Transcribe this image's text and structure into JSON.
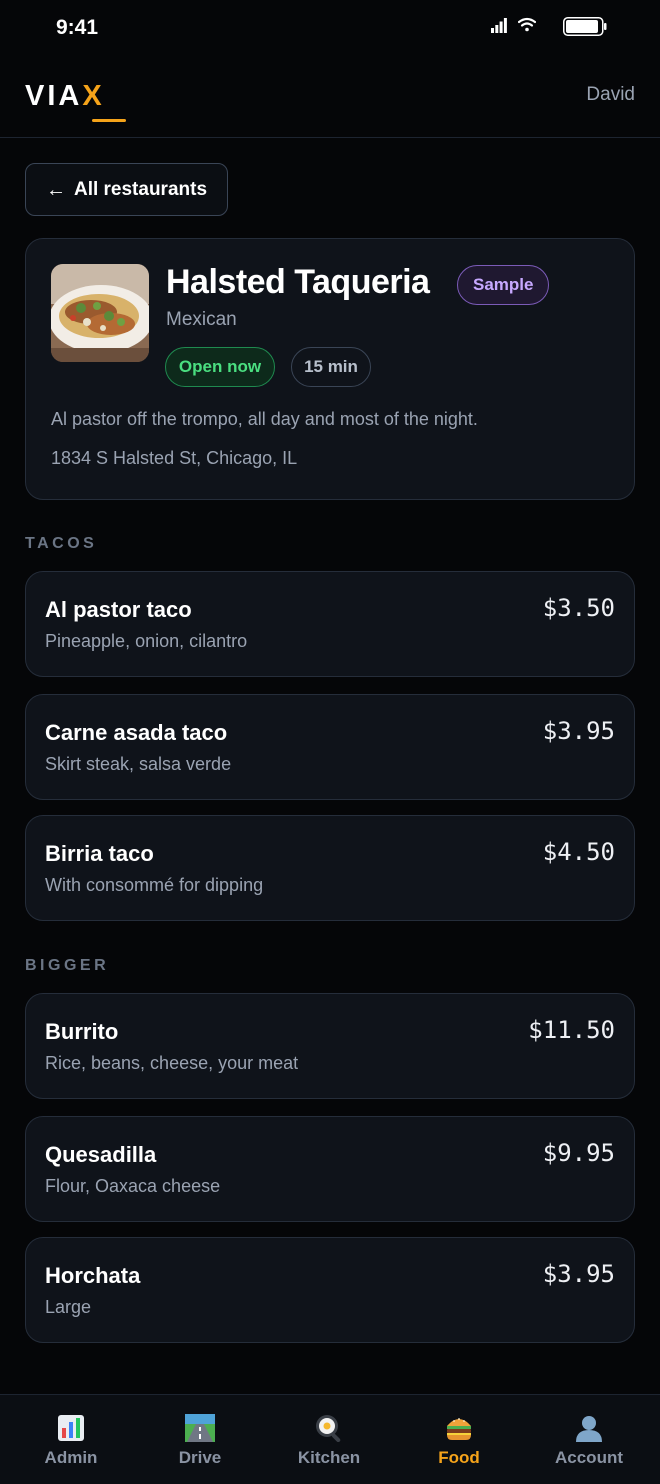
{
  "status_bar": {
    "time": "9:41"
  },
  "header": {
    "logo_main": "VIA",
    "logo_accent": "X",
    "user_name": "David"
  },
  "back_button": {
    "arrow": "←",
    "label": "All restaurants"
  },
  "restaurant": {
    "name": "Halsted Taqueria",
    "badge": "Sample",
    "cuisine": "Mexican",
    "status": "Open now",
    "eta": "15 min",
    "description": "Al pastor off the trompo, all day and most of the night.",
    "address": "1834 S Halsted St, Chicago, IL"
  },
  "sections": [
    {
      "heading": "TACOS",
      "items": [
        {
          "name": "Al pastor taco",
          "description": "Pineapple, onion, cilantro",
          "price": "$3.50"
        },
        {
          "name": "Carne asada taco",
          "description": "Skirt steak, salsa verde",
          "price": "$3.95"
        },
        {
          "name": "Birria taco",
          "description": "With consommé for dipping",
          "price": "$4.50"
        }
      ]
    },
    {
      "heading": "BIGGER",
      "items": [
        {
          "name": "Burrito",
          "description": "Rice, beans, cheese, your meat",
          "price": "$11.50"
        },
        {
          "name": "Quesadilla",
          "description": "Flour, Oaxaca cheese",
          "price": "$9.95"
        },
        {
          "name": "Horchata",
          "description": "Large",
          "price": "$3.95"
        }
      ]
    }
  ],
  "tabs": [
    {
      "label": "Admin",
      "icon": "bar-chart-icon"
    },
    {
      "label": "Drive",
      "icon": "road-icon"
    },
    {
      "label": "Kitchen",
      "icon": "frying-pan-icon"
    },
    {
      "label": "Food",
      "icon": "burger-icon",
      "active": true
    },
    {
      "label": "Account",
      "icon": "user-icon"
    }
  ],
  "colors": {
    "accent": "#f5a31a",
    "background": "#050608",
    "card": "#0f131a",
    "open_green": "#4ade80",
    "sample_purple": "#c7a8ff"
  }
}
